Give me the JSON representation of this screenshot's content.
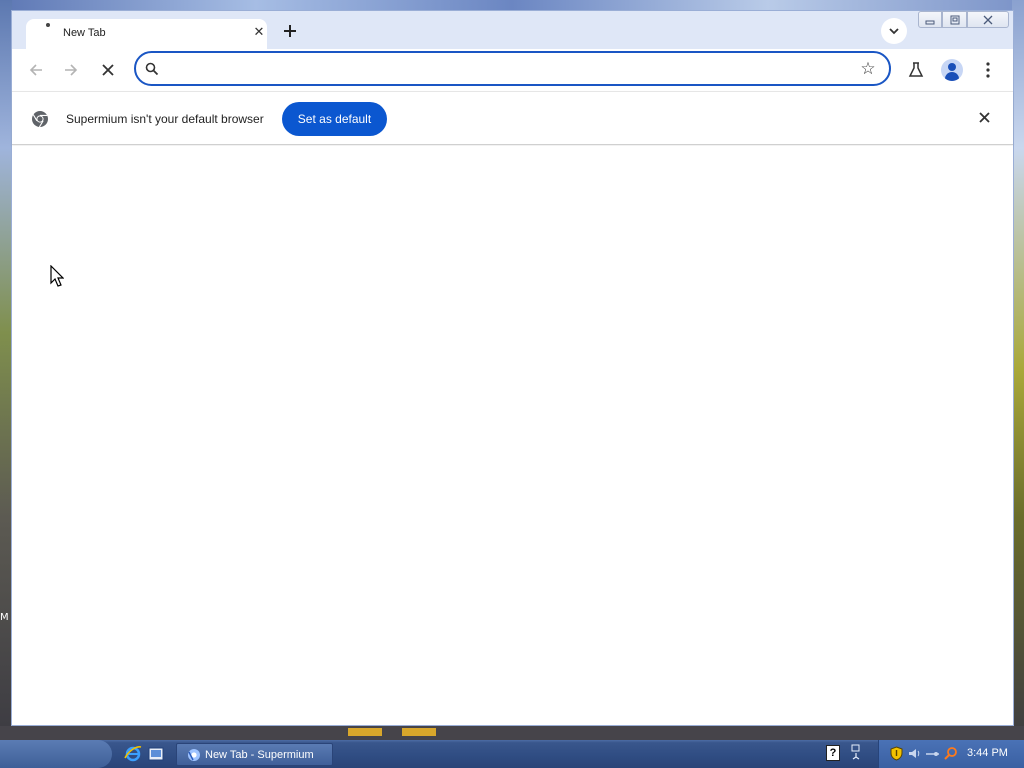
{
  "desktop": {
    "edge_letter": "M"
  },
  "browser": {
    "tab": {
      "title": "New Tab",
      "close_icon": "close-icon"
    },
    "new_tab_icon": "plus-icon",
    "tab_search_icon": "chevron-down-icon",
    "window_controls": [
      "minimize-icon",
      "maximize-icon",
      "close-icon"
    ],
    "toolbar": {
      "back_icon": "arrow-left-icon",
      "forward_icon": "arrow-right-icon",
      "stop_icon": "close-icon",
      "omnibox": {
        "value": "",
        "placeholder": "",
        "search_icon": "search-icon",
        "bookmark_icon": "star-icon"
      },
      "labs_icon": "flask-icon",
      "profile_icon": "avatar-icon",
      "menu_icon": "more-vertical-icon"
    },
    "infobar": {
      "icon": "chromium-logo-icon",
      "message": "Supermium isn't your default browser",
      "button_label": "Set as default",
      "close_icon": "close-icon"
    },
    "colors": {
      "accent": "#0b57d0",
      "omnibox_border": "#1a56c4",
      "tabstrip_bg": "#dfe7f7"
    }
  },
  "taskbar": {
    "quick_launch": [
      "internet-explorer-icon",
      "show-desktop-icon"
    ],
    "task_button_label": "New Tab - Supermium",
    "tray": {
      "clock": "3:44 PM",
      "icons": [
        "help-icon",
        "network-icon",
        "security-shield-icon",
        "sound-icon",
        "magnifier-icon"
      ]
    }
  }
}
